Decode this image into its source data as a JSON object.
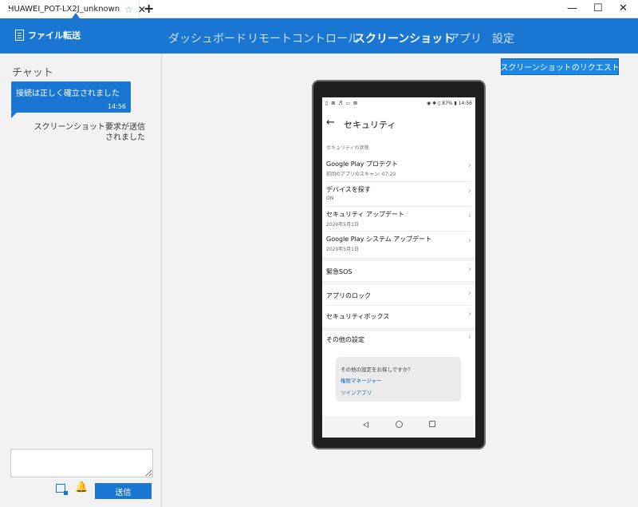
{
  "titlebar": {
    "tab_title": "HUAWEI_POT-LX2J_unknown",
    "star_glyph": "☆",
    "close_glyph": "✕",
    "new_tab_glyph": "+",
    "minimize_glyph": "—",
    "maximize_glyph": "☐",
    "window_close_glyph": "✕"
  },
  "header": {
    "file_transfer_label": "ファイル転送",
    "nav": [
      {
        "label": "ダッシュボード"
      },
      {
        "label": "リモートコントロール"
      },
      {
        "label": "スクリーンショット",
        "active": true
      },
      {
        "label": "アプリ"
      },
      {
        "label": "設定"
      }
    ]
  },
  "chat": {
    "title": "チャット",
    "bubble_text": "接続は正しく確立されました",
    "bubble_time": "14:56",
    "status_line1": "スクリーンショット要求が送信",
    "status_line2": "されました",
    "input_value": "",
    "send_label": "送信"
  },
  "main": {
    "screenshot_request_label": "スクリーンショットのリクエスト"
  },
  "phone": {
    "status_left": "▯ ⊠ ♬ ▭ ⊠",
    "status_right": "◉ ✱ ▯ 87% ▮ 14:56",
    "back_glyph": "←",
    "page_title": "セキュリティ",
    "section_label": "セキュリティの状態",
    "rows": [
      {
        "title": "Google Play プロテクト",
        "subtitle": "前回のアプリのスキャン: 07:20"
      },
      {
        "title": "デバイスを探す",
        "subtitle": "ON"
      },
      {
        "title": "セキュリティ アップデート",
        "subtitle": "2020年5月1日"
      },
      {
        "title": "Google Play システム アップデート",
        "subtitle": "2020年5月1日"
      },
      {
        "title": "緊急SOS"
      },
      {
        "title": "アプリのロック"
      },
      {
        "title": "セキュリティボックス"
      },
      {
        "title": "その他の設定"
      }
    ],
    "chevron_glyph": "›",
    "suggest_question": "その他の設定をお探しですか？",
    "suggest_link1": "権限マネージャー",
    "suggest_link2": "ツインアプリ"
  },
  "colors": {
    "accent": "#1976d2",
    "link": "#1565c0"
  }
}
